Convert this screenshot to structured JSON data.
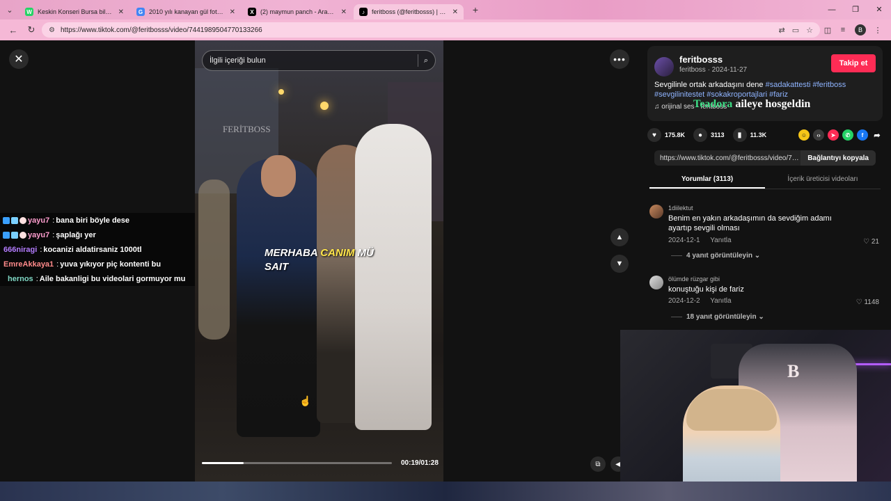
{
  "browser": {
    "tabs": [
      {
        "title": "Keskin Konseri Bursa biletleri | ...",
        "favicon": "whatsapp-icon",
        "color": "#25d366",
        "glyph": "W"
      },
      {
        "title": "2010 yılı kanayan gül fotosu - G...",
        "favicon": "google-icon",
        "color": "#4285f4",
        "glyph": "G"
      },
      {
        "title": "(2) maymun panch - Arama / X",
        "favicon": "x-icon",
        "color": "#000000",
        "glyph": "X"
      },
      {
        "title": "feritboss (@feritbosss) | Ti...",
        "favicon": "tiktok-icon",
        "color": "#000000",
        "glyph": "♪"
      }
    ],
    "url": "https://www.tiktok.com/@feritbosss/video/7441989504770133266",
    "profile_initial": "B"
  },
  "video": {
    "search_placeholder": "İlgili içeriği bulun",
    "watermark": "FERİTBOSS",
    "caption_part1": "MERHABA",
    "caption_highlight": "CANIM",
    "caption_part2": "MÜ SAIT",
    "timecode": "00:19/01:28",
    "progress": 0.22
  },
  "chat": [
    {
      "user": "yayu7",
      "message": "bana biri böyle dese",
      "color": "#ff9ecf",
      "badges": true
    },
    {
      "user": "yayu7",
      "message": "şaplağı yer",
      "color": "#ff9ecf",
      "badges": true
    },
    {
      "user": "666niragi",
      "message": "kocanizi aldatirsaniz 1000tl",
      "color": "#b47cff",
      "badges": false
    },
    {
      "user": "EmreAkkaya1",
      "message": "yuva yıkıyor piç kontenti bu",
      "color": "#ff8a8a",
      "badges": false
    },
    {
      "user": "hernos",
      "message": "Aile bakanligi bu videolari gormuyor mu",
      "color": "#7fd7c4",
      "badges": false
    }
  ],
  "panel": {
    "author": "feritbosss",
    "author_sub": "feritboss · 2024-11-27",
    "follow": "Takip et",
    "desc_text": "Sevgilinle ortak arkadaşını dene ",
    "tags": [
      "#sadakattesti",
      "#feritboss",
      "#sevgilinitestet",
      "#sokakroportajlari",
      "#fariz"
    ],
    "music": "♫  orijinal ses - feritboss",
    "overlay_green": "Teadora",
    "overlay_white": " aileye hosgeldin",
    "likes": "175.8K",
    "comments": "3113",
    "saves": "11.3K",
    "link": "https://www.tiktok.com/@feritbosss/video/74...",
    "copy_label": "Bağlantıyı kopyala",
    "tab_comments": "Yorumlar (3113)",
    "tab_creator": "İçerik üreticisi videoları"
  },
  "comments": [
    {
      "user": "1diilektut",
      "text": "Benim en yakın arkadaşımın da sevdiğim adamı ayartıp sevgili olması",
      "date": "2024-12-1",
      "reply": "Yanıtla",
      "likes": "21",
      "replies": "4 yanıt görüntüleyin ⌄"
    },
    {
      "user": "ölümde rüzgar gibi",
      "text": "konuştuğu kişi de fariz",
      "date": "2024-12-2",
      "reply": "Yanıtla",
      "likes": "1148",
      "replies": "18 yanıt görüntüleyin ⌄"
    }
  ]
}
